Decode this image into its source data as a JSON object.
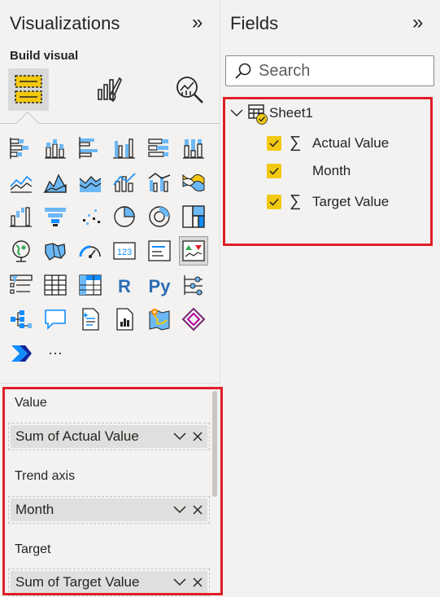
{
  "visualizations": {
    "title": "Visualizations",
    "subtitle": "Build visual",
    "tabs": [
      {
        "name": "build-visual",
        "active": true
      },
      {
        "name": "format-visual",
        "active": false
      },
      {
        "name": "analytics",
        "active": false
      }
    ],
    "gallery_icons": [
      "stacked-bar-chart-icon",
      "stacked-column-chart-icon",
      "clustered-bar-chart-icon",
      "clustered-column-chart-icon",
      "100-stacked-bar-chart-icon",
      "100-stacked-column-chart-icon",
      "line-chart-icon",
      "area-chart-icon",
      "stacked-area-chart-icon",
      "line-and-stacked-column-chart-icon",
      "line-and-clustered-column-chart-icon",
      "ribbon-chart-icon",
      "waterfall-chart-icon",
      "funnel-chart-icon",
      "scatter-chart-icon",
      "pie-chart-icon",
      "donut-chart-icon",
      "treemap-icon",
      "map-icon",
      "filled-map-icon",
      "gauge-icon",
      "card-icon",
      "multi-row-card-icon",
      "kpi-icon",
      "slicer-icon",
      "table-icon",
      "matrix-icon",
      "r-script-visual-icon",
      "python-visual-icon",
      "key-influencers-icon",
      "decomposition-tree-icon",
      "qa-icon",
      "smart-narrative-icon",
      "paginated-report-icon",
      "azure-map-icon",
      "power-apps-icon",
      "power-automate-icon",
      "more-visuals-icon"
    ],
    "text_glyphs": {
      "r": "R",
      "py": "Py",
      "more": "···",
      "card": "123"
    },
    "wells": [
      {
        "label": "Value",
        "field": "Sum of Actual Value"
      },
      {
        "label": "Trend axis",
        "field": "Month"
      },
      {
        "label": "Target",
        "field": "Sum of Target Value"
      }
    ]
  },
  "fields": {
    "title": "Fields",
    "search_placeholder": "Search",
    "table": {
      "name": "Sheet1",
      "items": [
        {
          "label": "Actual Value",
          "checked": true,
          "sigma": true
        },
        {
          "label": "Month",
          "checked": true,
          "sigma": false
        },
        {
          "label": "Target Value",
          "checked": true,
          "sigma": true
        }
      ]
    }
  },
  "glyphs": {
    "collapse": "»",
    "sigma": "∑"
  },
  "colors": {
    "accent_yellow": "#f2c811",
    "highlight_red": "#e01e26",
    "pbi_blue": "#118dff"
  }
}
